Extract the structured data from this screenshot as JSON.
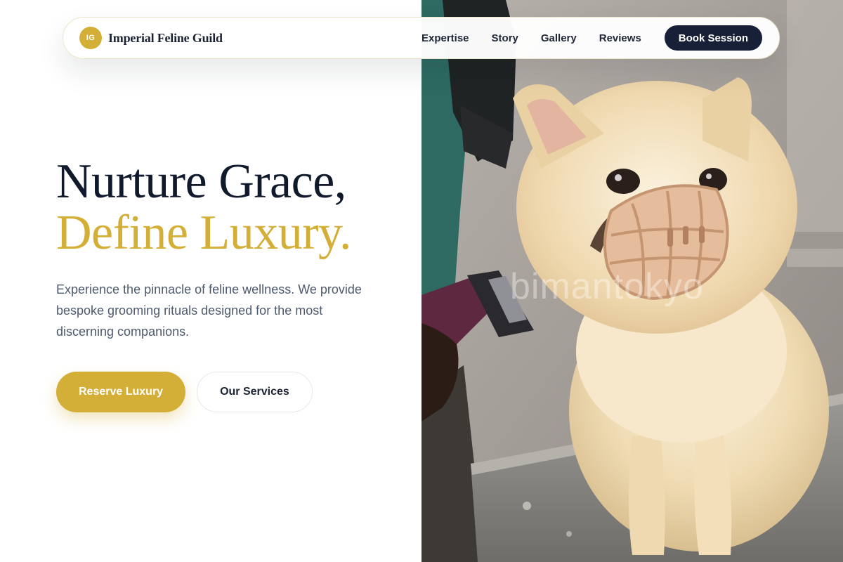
{
  "brand": {
    "initials": "IG",
    "name": "Imperial Feline Guild"
  },
  "nav": {
    "links": [
      {
        "label": "Expertise"
      },
      {
        "label": "Story"
      },
      {
        "label": "Gallery"
      },
      {
        "label": "Reviews"
      }
    ],
    "cta_label": "Book Session"
  },
  "hero": {
    "headline_line1": "Nurture Grace,",
    "headline_line2": "Define Luxury.",
    "lead": "Experience the pinnacle of feline wellness. We provide bespoke grooming rituals designed for the most discerning companions.",
    "primary_cta": "Reserve Luxury",
    "secondary_cta": "Our Services"
  },
  "hero_image": {
    "watermark": "bimantokyo",
    "subject": "cream-colored dog wearing a muzzle being groomed with clippers"
  },
  "colors": {
    "accent_gold": "#d4af37",
    "navy": "#172036",
    "heading": "#111a2c",
    "body_text": "#4d5a6e"
  }
}
